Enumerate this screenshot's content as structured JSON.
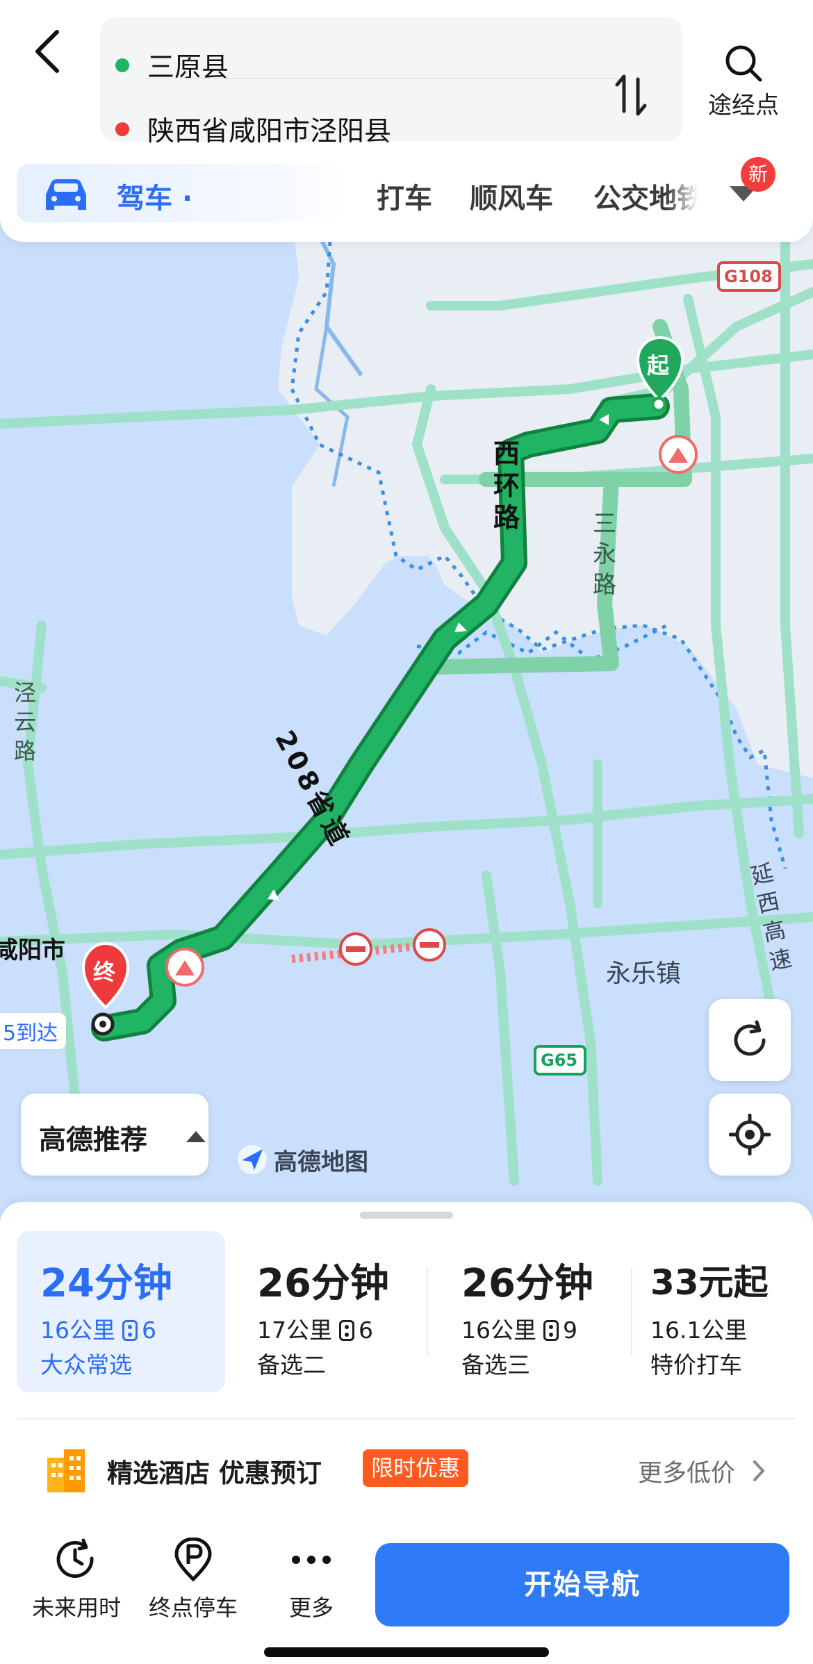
{
  "header": {
    "start": "三原县",
    "end": "陕西省咸阳市泾阳县",
    "waypoint_label": "途经点"
  },
  "modes": {
    "active": "驾车 ·",
    "tabs": [
      "打车",
      "顺风车",
      "公交地铁"
    ],
    "new_badge": "新"
  },
  "map": {
    "labels": {
      "xihuan_road": "西环路",
      "sanyong_road": "三永路",
      "provincial_208": "208省道",
      "jingyun_road": "泾云路",
      "xianyang": "咸阳市",
      "yongle_town": "永乐镇",
      "yanxi_expressway": "延西高速",
      "g108": "G108",
      "g65": "G65",
      "arrive_fragment": "5到达"
    },
    "start_marker": "起",
    "end_marker": "终",
    "recommend_label": "高德推荐",
    "logo_text": "高德地图",
    "colors": {
      "water": "#c9dffb",
      "road": "#9fe0c9",
      "route": "#1fa75c",
      "boundary": "#3b8fe6"
    }
  },
  "routes": [
    {
      "time": "24分钟",
      "distance": "16公里",
      "lights": "6",
      "tag": "大众常选",
      "selected": true
    },
    {
      "time": "26分钟",
      "distance": "17公里",
      "lights": "6",
      "tag": "备选二",
      "selected": false
    },
    {
      "time": "26分钟",
      "distance": "16公里",
      "lights": "9",
      "tag": "备选三",
      "selected": false
    },
    {
      "time": "33元起",
      "distance": "16.1公里",
      "lights": "",
      "tag": "特价打车",
      "selected": false
    }
  ],
  "hotel": {
    "title": "精选酒店 优惠预订",
    "promo": "限时优惠",
    "more": "更多低价"
  },
  "actions": {
    "future_time": "未来用时",
    "dest_parking": "终点停车",
    "more": "更多",
    "start_nav": "开始导航"
  }
}
